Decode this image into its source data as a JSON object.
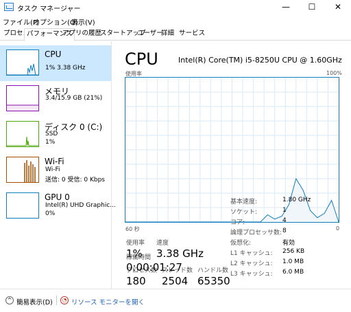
{
  "window": {
    "title": "タスク マネージャー",
    "minimize": "—",
    "maximize": "☐",
    "close": "✕"
  },
  "menu": [
    "ファイル(F)",
    "オプション(O)",
    "表示(V)"
  ],
  "tabs": [
    "プロセス",
    "パフォーマンス",
    "アプリの履歴",
    "スタートアップ",
    "ユーザー",
    "詳細",
    "サービス"
  ],
  "active_tab": "パフォーマンス",
  "resources": [
    {
      "name": "CPU",
      "sub1": "1% 3.38 GHz",
      "sub2": "",
      "color": "#117dbb"
    },
    {
      "name": "メモリ",
      "sub1": "3.4/15.9 GB (21%)",
      "sub2": "",
      "color": "#8b12ae"
    },
    {
      "name": "ディスク 0 (C:)",
      "sub1": "SSD",
      "sub2": "1%",
      "color": "#4da60c"
    },
    {
      "name": "Wi-Fi",
      "sub1": "Wi-Fi",
      "sub2": "送信: 0 受信: 0 Kbps",
      "color": "#a74f01"
    },
    {
      "name": "GPU 0",
      "sub1": "Intel(R) UHD Graphic...",
      "sub2": "0%",
      "color": "#117dbb"
    }
  ],
  "detail": {
    "title": "CPU",
    "model": "Intel(R) Core(TM) i5-8250U CPU @ 1.60GHz",
    "usage_label": "使用率",
    "max_label": "100%",
    "time_left": "60 秒",
    "time_right": "0",
    "stats": {
      "usage_label": "使用率",
      "usage": "1%",
      "speed_label": "速度",
      "speed": "3.38 GHz",
      "processes_label": "プロセス数",
      "processes": "180",
      "threads_label": "スレッド数",
      "threads": "2504",
      "handles_label": "ハンドル数",
      "handles": "65350",
      "uptime_label": "稼働時間",
      "uptime": "0:00:01:27"
    },
    "specs": [
      {
        "label": "基本速度:",
        "value": "1.80 GHz"
      },
      {
        "label": "ソケット:",
        "value": "1"
      },
      {
        "label": "コア:",
        "value": "4"
      },
      {
        "label": "論理プロセッサ数:",
        "value": "8"
      },
      {
        "label": "仮想化:",
        "value": "有効"
      },
      {
        "label": "L1 キャッシュ:",
        "value": "256 KB"
      },
      {
        "label": "L2 キャッシュ:",
        "value": "1.0 MB"
      },
      {
        "label": "L3 キャッシュ:",
        "value": "6.0 MB"
      }
    ]
  },
  "footer": {
    "fewer_details": "簡易表示(D)",
    "resource_monitor": "リソース モニターを開く"
  },
  "chart_data": {
    "type": "area",
    "ylim": [
      0,
      100
    ],
    "x": [
      0,
      38,
      40,
      42,
      44,
      46,
      48,
      50,
      52,
      54,
      56,
      58,
      60
    ],
    "values": [
      0,
      0,
      5,
      2,
      4,
      12,
      30,
      22,
      8,
      3,
      6,
      15,
      0
    ]
  }
}
